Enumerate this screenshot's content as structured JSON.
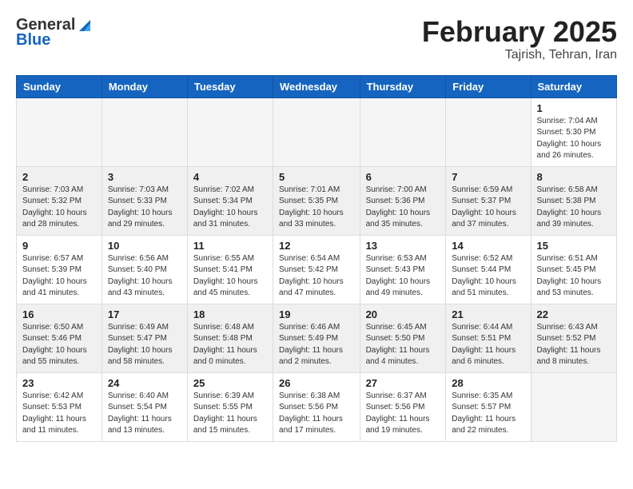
{
  "header": {
    "logo_general": "General",
    "logo_blue": "Blue",
    "title": "February 2025",
    "subtitle": "Tajrish, Tehran, Iran"
  },
  "days_of_week": [
    "Sunday",
    "Monday",
    "Tuesday",
    "Wednesday",
    "Thursday",
    "Friday",
    "Saturday"
  ],
  "weeks": [
    [
      {
        "day": "",
        "info": ""
      },
      {
        "day": "",
        "info": ""
      },
      {
        "day": "",
        "info": ""
      },
      {
        "day": "",
        "info": ""
      },
      {
        "day": "",
        "info": ""
      },
      {
        "day": "",
        "info": ""
      },
      {
        "day": "1",
        "info": "Sunrise: 7:04 AM\nSunset: 5:30 PM\nDaylight: 10 hours and 26 minutes."
      }
    ],
    [
      {
        "day": "2",
        "info": "Sunrise: 7:03 AM\nSunset: 5:32 PM\nDaylight: 10 hours and 28 minutes."
      },
      {
        "day": "3",
        "info": "Sunrise: 7:03 AM\nSunset: 5:33 PM\nDaylight: 10 hours and 29 minutes."
      },
      {
        "day": "4",
        "info": "Sunrise: 7:02 AM\nSunset: 5:34 PM\nDaylight: 10 hours and 31 minutes."
      },
      {
        "day": "5",
        "info": "Sunrise: 7:01 AM\nSunset: 5:35 PM\nDaylight: 10 hours and 33 minutes."
      },
      {
        "day": "6",
        "info": "Sunrise: 7:00 AM\nSunset: 5:36 PM\nDaylight: 10 hours and 35 minutes."
      },
      {
        "day": "7",
        "info": "Sunrise: 6:59 AM\nSunset: 5:37 PM\nDaylight: 10 hours and 37 minutes."
      },
      {
        "day": "8",
        "info": "Sunrise: 6:58 AM\nSunset: 5:38 PM\nDaylight: 10 hours and 39 minutes."
      }
    ],
    [
      {
        "day": "9",
        "info": "Sunrise: 6:57 AM\nSunset: 5:39 PM\nDaylight: 10 hours and 41 minutes."
      },
      {
        "day": "10",
        "info": "Sunrise: 6:56 AM\nSunset: 5:40 PM\nDaylight: 10 hours and 43 minutes."
      },
      {
        "day": "11",
        "info": "Sunrise: 6:55 AM\nSunset: 5:41 PM\nDaylight: 10 hours and 45 minutes."
      },
      {
        "day": "12",
        "info": "Sunrise: 6:54 AM\nSunset: 5:42 PM\nDaylight: 10 hours and 47 minutes."
      },
      {
        "day": "13",
        "info": "Sunrise: 6:53 AM\nSunset: 5:43 PM\nDaylight: 10 hours and 49 minutes."
      },
      {
        "day": "14",
        "info": "Sunrise: 6:52 AM\nSunset: 5:44 PM\nDaylight: 10 hours and 51 minutes."
      },
      {
        "day": "15",
        "info": "Sunrise: 6:51 AM\nSunset: 5:45 PM\nDaylight: 10 hours and 53 minutes."
      }
    ],
    [
      {
        "day": "16",
        "info": "Sunrise: 6:50 AM\nSunset: 5:46 PM\nDaylight: 10 hours and 55 minutes."
      },
      {
        "day": "17",
        "info": "Sunrise: 6:49 AM\nSunset: 5:47 PM\nDaylight: 10 hours and 58 minutes."
      },
      {
        "day": "18",
        "info": "Sunrise: 6:48 AM\nSunset: 5:48 PM\nDaylight: 11 hours and 0 minutes."
      },
      {
        "day": "19",
        "info": "Sunrise: 6:46 AM\nSunset: 5:49 PM\nDaylight: 11 hours and 2 minutes."
      },
      {
        "day": "20",
        "info": "Sunrise: 6:45 AM\nSunset: 5:50 PM\nDaylight: 11 hours and 4 minutes."
      },
      {
        "day": "21",
        "info": "Sunrise: 6:44 AM\nSunset: 5:51 PM\nDaylight: 11 hours and 6 minutes."
      },
      {
        "day": "22",
        "info": "Sunrise: 6:43 AM\nSunset: 5:52 PM\nDaylight: 11 hours and 8 minutes."
      }
    ],
    [
      {
        "day": "23",
        "info": "Sunrise: 6:42 AM\nSunset: 5:53 PM\nDaylight: 11 hours and 11 minutes."
      },
      {
        "day": "24",
        "info": "Sunrise: 6:40 AM\nSunset: 5:54 PM\nDaylight: 11 hours and 13 minutes."
      },
      {
        "day": "25",
        "info": "Sunrise: 6:39 AM\nSunset: 5:55 PM\nDaylight: 11 hours and 15 minutes."
      },
      {
        "day": "26",
        "info": "Sunrise: 6:38 AM\nSunset: 5:56 PM\nDaylight: 11 hours and 17 minutes."
      },
      {
        "day": "27",
        "info": "Sunrise: 6:37 AM\nSunset: 5:56 PM\nDaylight: 11 hours and 19 minutes."
      },
      {
        "day": "28",
        "info": "Sunrise: 6:35 AM\nSunset: 5:57 PM\nDaylight: 11 hours and 22 minutes."
      },
      {
        "day": "",
        "info": ""
      }
    ]
  ]
}
